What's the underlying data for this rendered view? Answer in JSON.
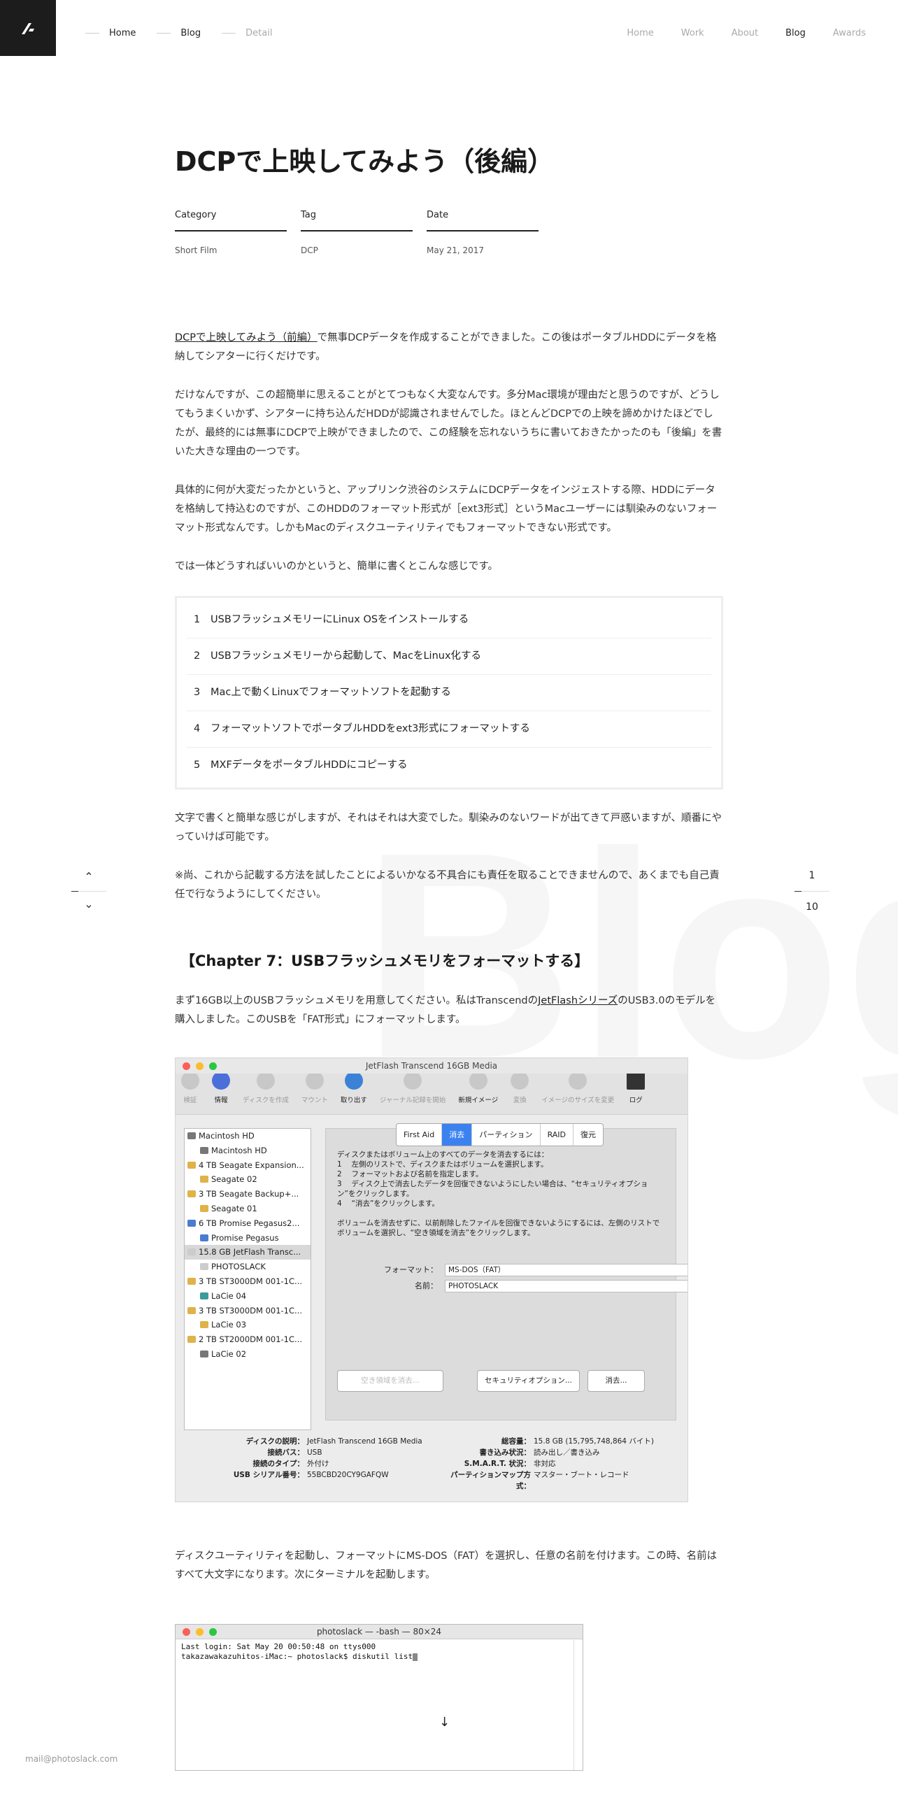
{
  "nav": {
    "breadcrumbs": [
      "Home",
      "Blog",
      "Detail"
    ],
    "menu": [
      "Home",
      "Work",
      "About",
      "Blog",
      "Awards"
    ],
    "active": "Blog"
  },
  "watermark": "Blog",
  "post": {
    "title": "DCPで上映してみよう（後編）",
    "meta": {
      "category_label": "Category",
      "category": "Short Film",
      "tag_label": "Tag",
      "tag": "DCP",
      "date_label": "Date",
      "date": "May 21, 2017"
    },
    "p1_link": "DCPで上映してみよう（前編）",
    "p1_rest": "で無事DCPデータを作成することができました。この後はポータブルHDDにデータを格納してシアターに行くだけです。",
    "p2": "だけなんですが、この超簡単に思えることがとてつもなく大変なんです。多分Mac環境が理由だと思うのですが、どうしてもうまくいかず、シアターに持ち込んだHDDが認識されませんでした。ほとんどDCPでの上映を諦めかけたほどでしたが、最終的には無事にDCPで上映ができましたので、この経験を忘れないうちに書いておきたかったのも「後編」を書いた大きな理由の一つです。",
    "p3": "具体的に何が大変だったかというと、アップリンク渋谷のシステムにDCPデータをインジェストする際、HDDにデータを格納して持込むのですが、このHDDのフォーマット形式が［ext3形式］というMacユーザーには馴染みのないフォーマット形式なんです。しかもMacのディスクユーティリティでもフォーマットできない形式です。",
    "p4": "では一体どうすればいいのかというと、簡単に書くとこんな感じです。",
    "steps": [
      {
        "num": "1",
        "text": "USBフラッシュメモリーにLinux OSをインストールする"
      },
      {
        "num": "2",
        "text": "USBフラッシュメモリーから起動して、MacをLinux化する"
      },
      {
        "num": "3",
        "text": "Mac上で動くLinuxでフォーマットソフトを起動する"
      },
      {
        "num": "4",
        "text": "フォーマットソフトでポータブルHDDをext3形式にフォーマットする"
      },
      {
        "num": "5",
        "text": "MXFデータをポータブルHDDにコピーする"
      }
    ],
    "p5": "文字で書くと簡単な感じがしますが、それはそれは大変でした。馴染みのないワードが出てきて戸惑いますが、順番にやっていけば可能です。",
    "p6": "※尚、これから記載する方法を試したことによるいかなる不具合にも責任を取ることできませんので、あくまでも自己責任で行なうようにしてください。",
    "chapter": "【Chapter 7：USBフラッシュメモリをフォーマットする】",
    "p7_a": "まず16GB以上のUSBフラッシュメモリを用意してください。私はTranscendの",
    "p7_link": "JetFlashシリーズ",
    "p7_b": "のUSB3.0のモデルを購入しました。このUSBを「FAT形式」にフォーマットします。",
    "p8": "ディスクユーティリティを起動し、フォーマットにMS-DOS（FAT）を選択し、任意の名前を付けます。この時、名前はすべて大文字になります。次にターミナルを起動します。"
  },
  "pager": {
    "current": "1",
    "total": "10",
    "up": "⌃",
    "down": "⌄"
  },
  "disk_utility": {
    "title": "JetFlash Transcend 16GB Media",
    "tools": [
      "検証",
      "情報",
      "ディスクを作成",
      "マウント",
      "取り出す",
      "ジャーナル記録を開始",
      "新規イメージ",
      "変換",
      "イメージのサイズを変更",
      "ログ"
    ],
    "sidebar": [
      {
        "label": "Macintosh HD",
        "sub": false,
        "kind": "gray"
      },
      {
        "label": "Macintosh HD",
        "sub": true,
        "kind": "gray"
      },
      {
        "label": "4 TB Seagate Expansion...",
        "sub": false,
        "kind": ""
      },
      {
        "label": "Seagate 02",
        "sub": true,
        "kind": ""
      },
      {
        "label": "3 TB Seagate Backup+...",
        "sub": false,
        "kind": ""
      },
      {
        "label": "Seagate 01",
        "sub": true,
        "kind": ""
      },
      {
        "label": "6 TB Promise Pegasus2...",
        "sub": false,
        "kind": "blue"
      },
      {
        "label": "Promise Pegasus",
        "sub": true,
        "kind": "blue"
      },
      {
        "label": "15.8 GB JetFlash Transc...",
        "sub": false,
        "kind": "usb"
      },
      {
        "label": "PHOTOSLACK",
        "sub": true,
        "kind": "usb"
      },
      {
        "label": "3 TB ST3000DM 001-1C...",
        "sub": false,
        "kind": ""
      },
      {
        "label": "LaCie 04",
        "sub": true,
        "kind": "green"
      },
      {
        "label": "3 TB ST3000DM 001-1C...",
        "sub": false,
        "kind": ""
      },
      {
        "label": "LaCie 03",
        "sub": true,
        "kind": ""
      },
      {
        "label": "2 TB ST2000DM 001-1C...",
        "sub": false,
        "kind": ""
      },
      {
        "label": "LaCie 02",
        "sub": true,
        "kind": "gray"
      }
    ],
    "selected_index": 8,
    "tabs": [
      "First Aid",
      "消去",
      "パーティション",
      "RAID",
      "復元"
    ],
    "active_tab": "消去",
    "instructions": [
      "ディスクまたはボリューム上のすべてのデータを消去するには：",
      "1　 左側のリストで、ディスクまたはボリュームを選択します。",
      "2　 フォーマットおよび名前を指定します。",
      "3　 ディスク上で消去したデータを回復できないようにしたい場合は、“セキュリティオプション”をクリックします。",
      "4　 “消去”をクリックします。",
      "",
      "ボリュームを消去せずに、以前削除したファイルを回復できないようにするには、左側のリストでボリュームを選択し、“空き領域を消去”をクリックします。"
    ],
    "format_label": "フォーマット：",
    "format_value": "MS-DOS（FAT）",
    "name_label": "名前：",
    "name_value": "PHOTOSLACK",
    "btn_free": "空き領域を消去...",
    "btn_security": "セキュリティオプション...",
    "btn_erase": "消去...",
    "info": [
      {
        "k1": "ディスクの説明：",
        "v1": "JetFlash Transcend 16GB Media",
        "k2": "総容量：",
        "v2": "15.8 GB (15,795,748,864 バイト)"
      },
      {
        "k1": "接続バス：",
        "v1": "USB",
        "k2": "書き込み状況：",
        "v2": "読み出し／書き込み"
      },
      {
        "k1": "接続のタイプ：",
        "v1": "外付け",
        "k2": "S.M.A.R.T. 状況：",
        "v2": "非対応"
      },
      {
        "k1": "USB シリアル番号：",
        "v1": "55BCBD20CY9GAFQW",
        "k2": "パーティションマップ方式：",
        "v2": "マスター・ブート・レコード"
      }
    ]
  },
  "terminal": {
    "title": "photoslack — -bash — 80×24",
    "lines": [
      "Last login: Sat May 20 00:50:48 on ttys000",
      "takazawakazuhitos-iMac:~ photoslack$ diskutil list"
    ]
  },
  "footer": {
    "email": "mail@photoslack.com",
    "down_arrow": "↓"
  }
}
